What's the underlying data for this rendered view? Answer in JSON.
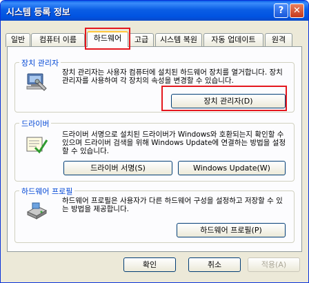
{
  "window": {
    "title": "시스템 등록 정보",
    "help_glyph": "?",
    "close_glyph": "✕"
  },
  "tabs": [
    {
      "label": "일반"
    },
    {
      "label": "컴퓨터 이름"
    },
    {
      "label": "하드웨어",
      "active": true
    },
    {
      "label": "고급"
    },
    {
      "label": "시스템 복원"
    },
    {
      "label": "자동 업데이트"
    },
    {
      "label": "원격"
    }
  ],
  "groups": {
    "device_manager": {
      "title": "장치 관리자",
      "description": "장치 관리자는 사용자 컴퓨터에 설치된 하드웨어 장치를 열거합니다. 장치 관리자를 사용하여 각 장치의 속성을 변경할 수 있습니다.",
      "button": "장치 관리자(D)",
      "icon": "device-manager-icon"
    },
    "drivers": {
      "title": "드라이버",
      "description": "드라이버 서명으로 설치된 드라이버가 Windows와 호환되는지 확인할 수 있으며 드라이버 검색을 위해 Windows Update에 연결하는 방법을 설정할 수 있습니다.",
      "button_signing": "드라이버 서명(S)",
      "button_update": "Windows Update(W)",
      "icon": "driver-signing-icon"
    },
    "hardware_profiles": {
      "title": "하드웨어 프로필",
      "description": "하드웨어 프로필은 사용자가 다른 하드웨어 구성을 설정하고 저장할 수 있는 방법을 제공합니다.",
      "button": "하드웨어 프로필(P)",
      "icon": "hardware-profile-icon"
    }
  },
  "footer": {
    "ok": "확인",
    "cancel": "취소",
    "apply": "적용(A)"
  },
  "colors": {
    "titlebar": "#0054e3",
    "group_title": "#0046d5",
    "highlight": "#e4161d",
    "dialog_bg": "#ece9d8"
  }
}
